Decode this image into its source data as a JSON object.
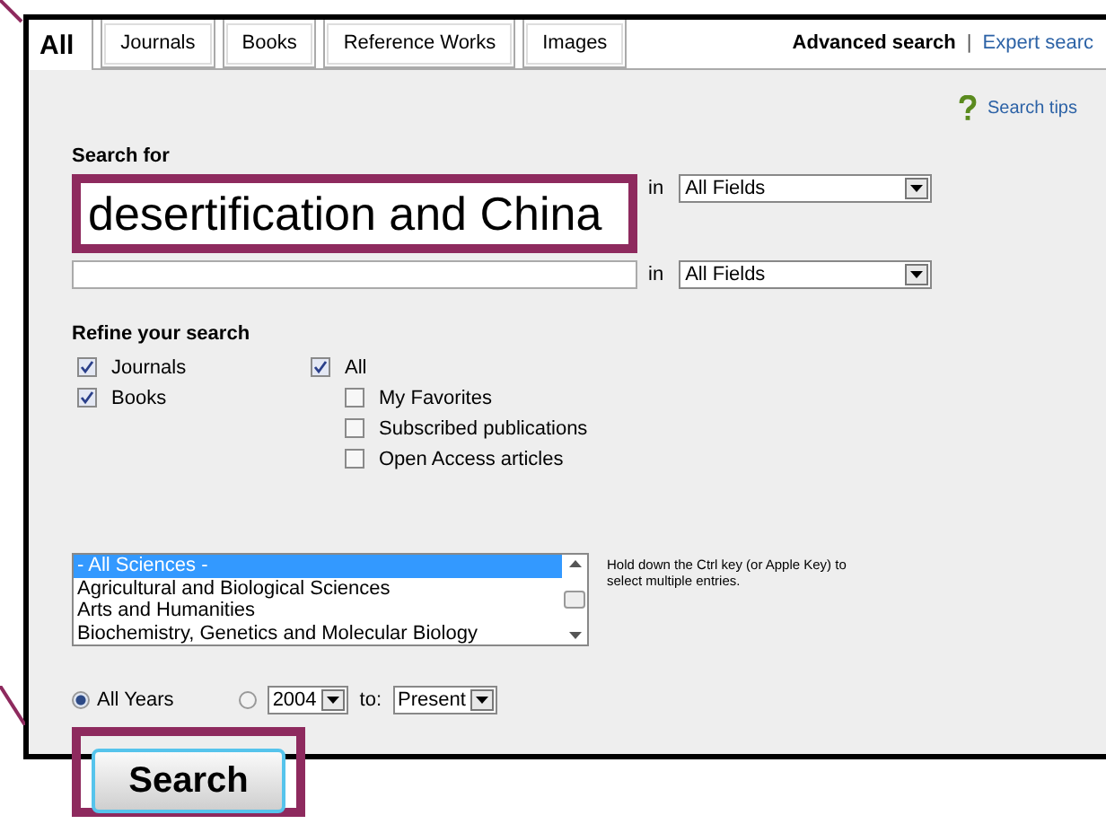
{
  "tabs": [
    {
      "label": "All",
      "selected": true
    },
    {
      "label": "Journals",
      "selected": false
    },
    {
      "label": "Books",
      "selected": false
    },
    {
      "label": "Reference Works",
      "selected": false
    },
    {
      "label": "Images",
      "selected": false
    }
  ],
  "header_links": [
    {
      "label": "Advanced search",
      "selected": true
    },
    {
      "label": "Expert searc",
      "selected": false
    }
  ],
  "header_separator": "|",
  "search_tips": "Search tips",
  "search_for": {
    "label": "Search for",
    "rows": [
      {
        "value": "desertification and China",
        "connector": "in",
        "field": "All Fields",
        "highlighted": true
      },
      {
        "connector": "in",
        "field": "All Fields",
        "highlighted": false
      }
    ]
  },
  "refine": {
    "label": "Refine your search",
    "sources": [
      {
        "label": "Journals",
        "checked": true
      },
      {
        "label": "Books",
        "checked": true
      }
    ],
    "access": {
      "label": "All",
      "checked": true,
      "children": [
        {
          "label": "My Favorites",
          "checked": false
        },
        {
          "label": "Subscribed publications",
          "checked": false
        },
        {
          "label": "Open Access articles",
          "checked": false
        }
      ]
    }
  },
  "subjects": {
    "items": [
      {
        "label": "- All Sciences -",
        "selected": true
      },
      {
        "label": "Agricultural and Biological Sciences",
        "selected": false
      },
      {
        "label": "Arts and Humanities",
        "selected": false
      },
      {
        "label": "Biochemistry, Genetics and Molecular Biology",
        "selected": false
      }
    ],
    "hint": "Hold down the Ctrl key (or Apple Key) to select multiple entries."
  },
  "dates": {
    "all_years": {
      "label": "All Years",
      "selected": true
    },
    "range": {
      "selected": false,
      "from": "2004",
      "to_label": "to:",
      "to": "Present"
    }
  },
  "search_button": {
    "label": "Search",
    "highlighted": true
  }
}
